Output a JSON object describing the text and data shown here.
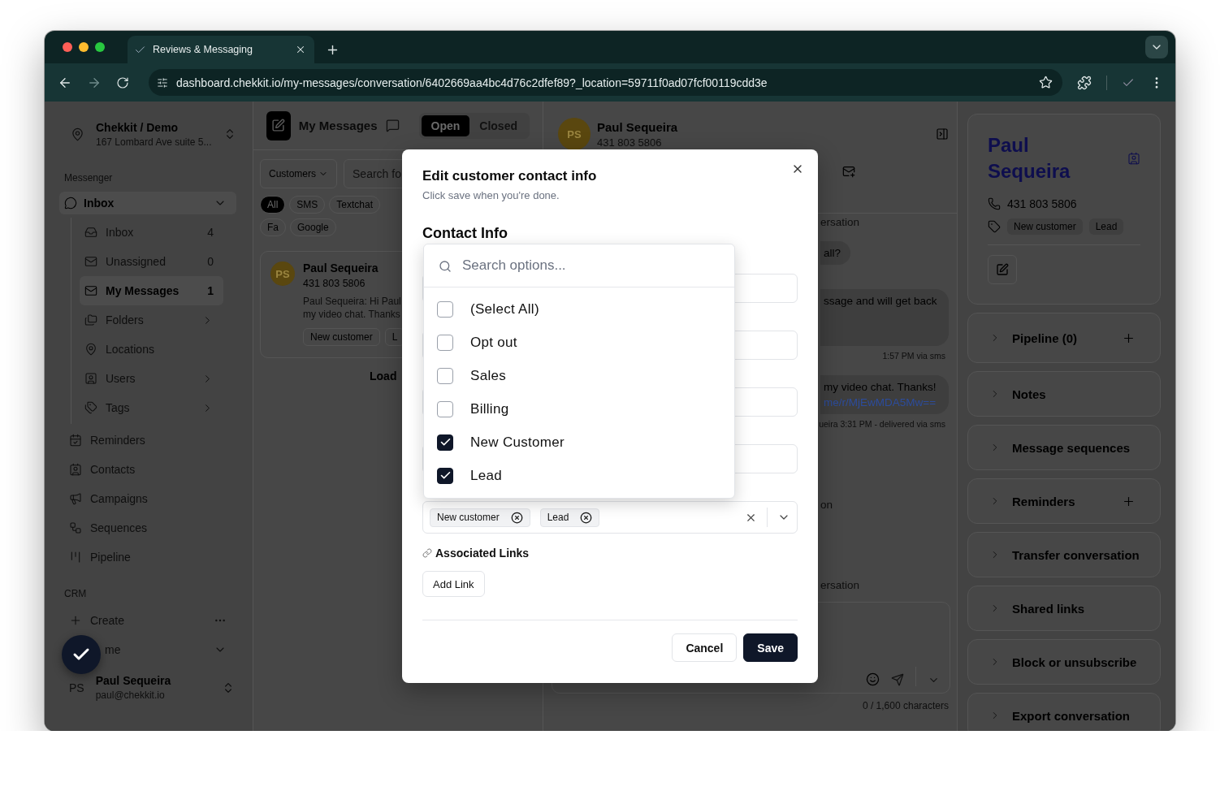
{
  "browser": {
    "tabs": [
      {
        "title": "Reviews & Messaging",
        "selected": true
      }
    ],
    "url": "dashboard.chekkit.io/my-messages/conversation/6402669aa4bc4d76c2dfef89?_location=59711f0ad07fcf00119cdd3e"
  },
  "sidebar": {
    "workspace": {
      "name": "Chekkit / Demo",
      "address": "167 Lombard Ave suite 5..."
    },
    "messenger_label": "Messenger",
    "inbox_group": {
      "label": "Inbox",
      "expanded": true,
      "children": [
        {
          "label": "Inbox",
          "count": "4",
          "submenu": false,
          "selected": false
        },
        {
          "label": "Unassigned",
          "count": "0",
          "submenu": false,
          "selected": false
        },
        {
          "label": "My Messages",
          "count": "1",
          "submenu": false,
          "selected": true
        },
        {
          "label": "Folders",
          "submenu": true,
          "selected": false
        },
        {
          "label": "Locations",
          "submenu": false,
          "selected": false
        },
        {
          "label": "Users",
          "submenu": true,
          "selected": false
        },
        {
          "label": "Tags",
          "submenu": true,
          "selected": false
        }
      ]
    },
    "nav_items": [
      {
        "label": "Reminders"
      },
      {
        "label": "Contacts"
      },
      {
        "label": "Campaigns"
      },
      {
        "label": "Sequences"
      },
      {
        "label": "Pipeline"
      }
    ],
    "crm_label": "CRM",
    "crm_items": [
      {
        "label": "Create",
        "kind": "action"
      },
      {
        "label": "me",
        "kind": "group",
        "expanded": false
      }
    ],
    "user": {
      "initials": "PS",
      "name": "Paul Sequeira",
      "email": "paul@chekkit.io"
    }
  },
  "list_panel": {
    "title": "My Messages",
    "status_tabs": [
      {
        "label": "Open",
        "selected": true
      },
      {
        "label": "Closed",
        "selected": false
      }
    ],
    "filter": {
      "label": "Customers"
    },
    "search": {
      "placeholder": "Search fo"
    },
    "channels": [
      {
        "label": "All",
        "selected": true
      },
      {
        "label": "SMS",
        "selected": false
      },
      {
        "label": "Textchat",
        "selected": false
      },
      {
        "label": "Fa",
        "selected": false
      },
      {
        "label": "Google",
        "selected": false
      }
    ],
    "conversations": [
      {
        "initials": "PS",
        "name": "Paul Sequeira",
        "phone": "431 803 5806",
        "preview_lines": [
          "Paul Sequeira: Hi Paul",
          "my video chat. Thanks"
        ],
        "tags": [
          "New customer",
          "L"
        ]
      }
    ],
    "load_more": "Load"
  },
  "chat": {
    "contact": {
      "initials": "PS",
      "name": "Paul Sequeira",
      "phone": "431 803 5806"
    },
    "items": [
      {
        "kind": "label",
        "text": "ersation"
      },
      {
        "kind": "bubble",
        "lines": [
          "all?"
        ]
      },
      {
        "kind": "bubble",
        "lines": [
          "ssage and will get back"
        ],
        "tall": true
      },
      {
        "kind": "meta",
        "text": "1:57 PM via sms"
      },
      {
        "kind": "bubble",
        "lines": [
          "my video chat. Thanks!"
        ],
        "link": "me/r/MjEwMDA5Mw=="
      },
      {
        "kind": "meta",
        "text": "ueira 3:31 PM - delivered via sms"
      },
      {
        "kind": "label",
        "text": "on"
      },
      {
        "kind": "label",
        "text": "ersation"
      }
    ],
    "counter": "0 / 1,600 characters"
  },
  "contact_panel": {
    "name": "Paul Sequeira",
    "phone": "431 803 5806",
    "tags": [
      "New customer",
      "Lead"
    ],
    "sections": [
      {
        "label": "Pipeline (0)",
        "addable": true
      },
      {
        "label": "Notes",
        "addable": false
      },
      {
        "label": "Message sequences",
        "addable": false
      },
      {
        "label": "Reminders",
        "addable": true
      },
      {
        "label": "Transfer conversation",
        "addable": false
      },
      {
        "label": "Shared links",
        "addable": false
      },
      {
        "label": "Block or unsubscribe",
        "addable": false
      },
      {
        "label": "Export conversation",
        "addable": false
      }
    ]
  },
  "modal": {
    "title": "Edit customer contact info",
    "subtitle": "Click save when you're done.",
    "section_title": "Contact Info",
    "fields": [
      {
        "kind": "text"
      },
      {
        "kind": "text"
      },
      {
        "kind": "text"
      },
      {
        "kind": "text"
      }
    ],
    "tag_select": {
      "values": [
        "New customer",
        "Lead"
      ]
    },
    "dropdown": {
      "open": true,
      "search_placeholder": "Search options...",
      "options": [
        {
          "label": "(Select All)",
          "checked": false
        },
        {
          "label": "Opt out",
          "checked": false
        },
        {
          "label": "Sales",
          "checked": false
        },
        {
          "label": "Billing",
          "checked": false
        },
        {
          "label": "New Customer",
          "checked": true
        },
        {
          "label": "Lead",
          "checked": true
        }
      ]
    },
    "links_label": "Associated Links",
    "add_link": "Add Link",
    "buttons": [
      {
        "label": "Cancel",
        "kind": "secondary"
      },
      {
        "label": "Save",
        "kind": "primary"
      }
    ]
  }
}
